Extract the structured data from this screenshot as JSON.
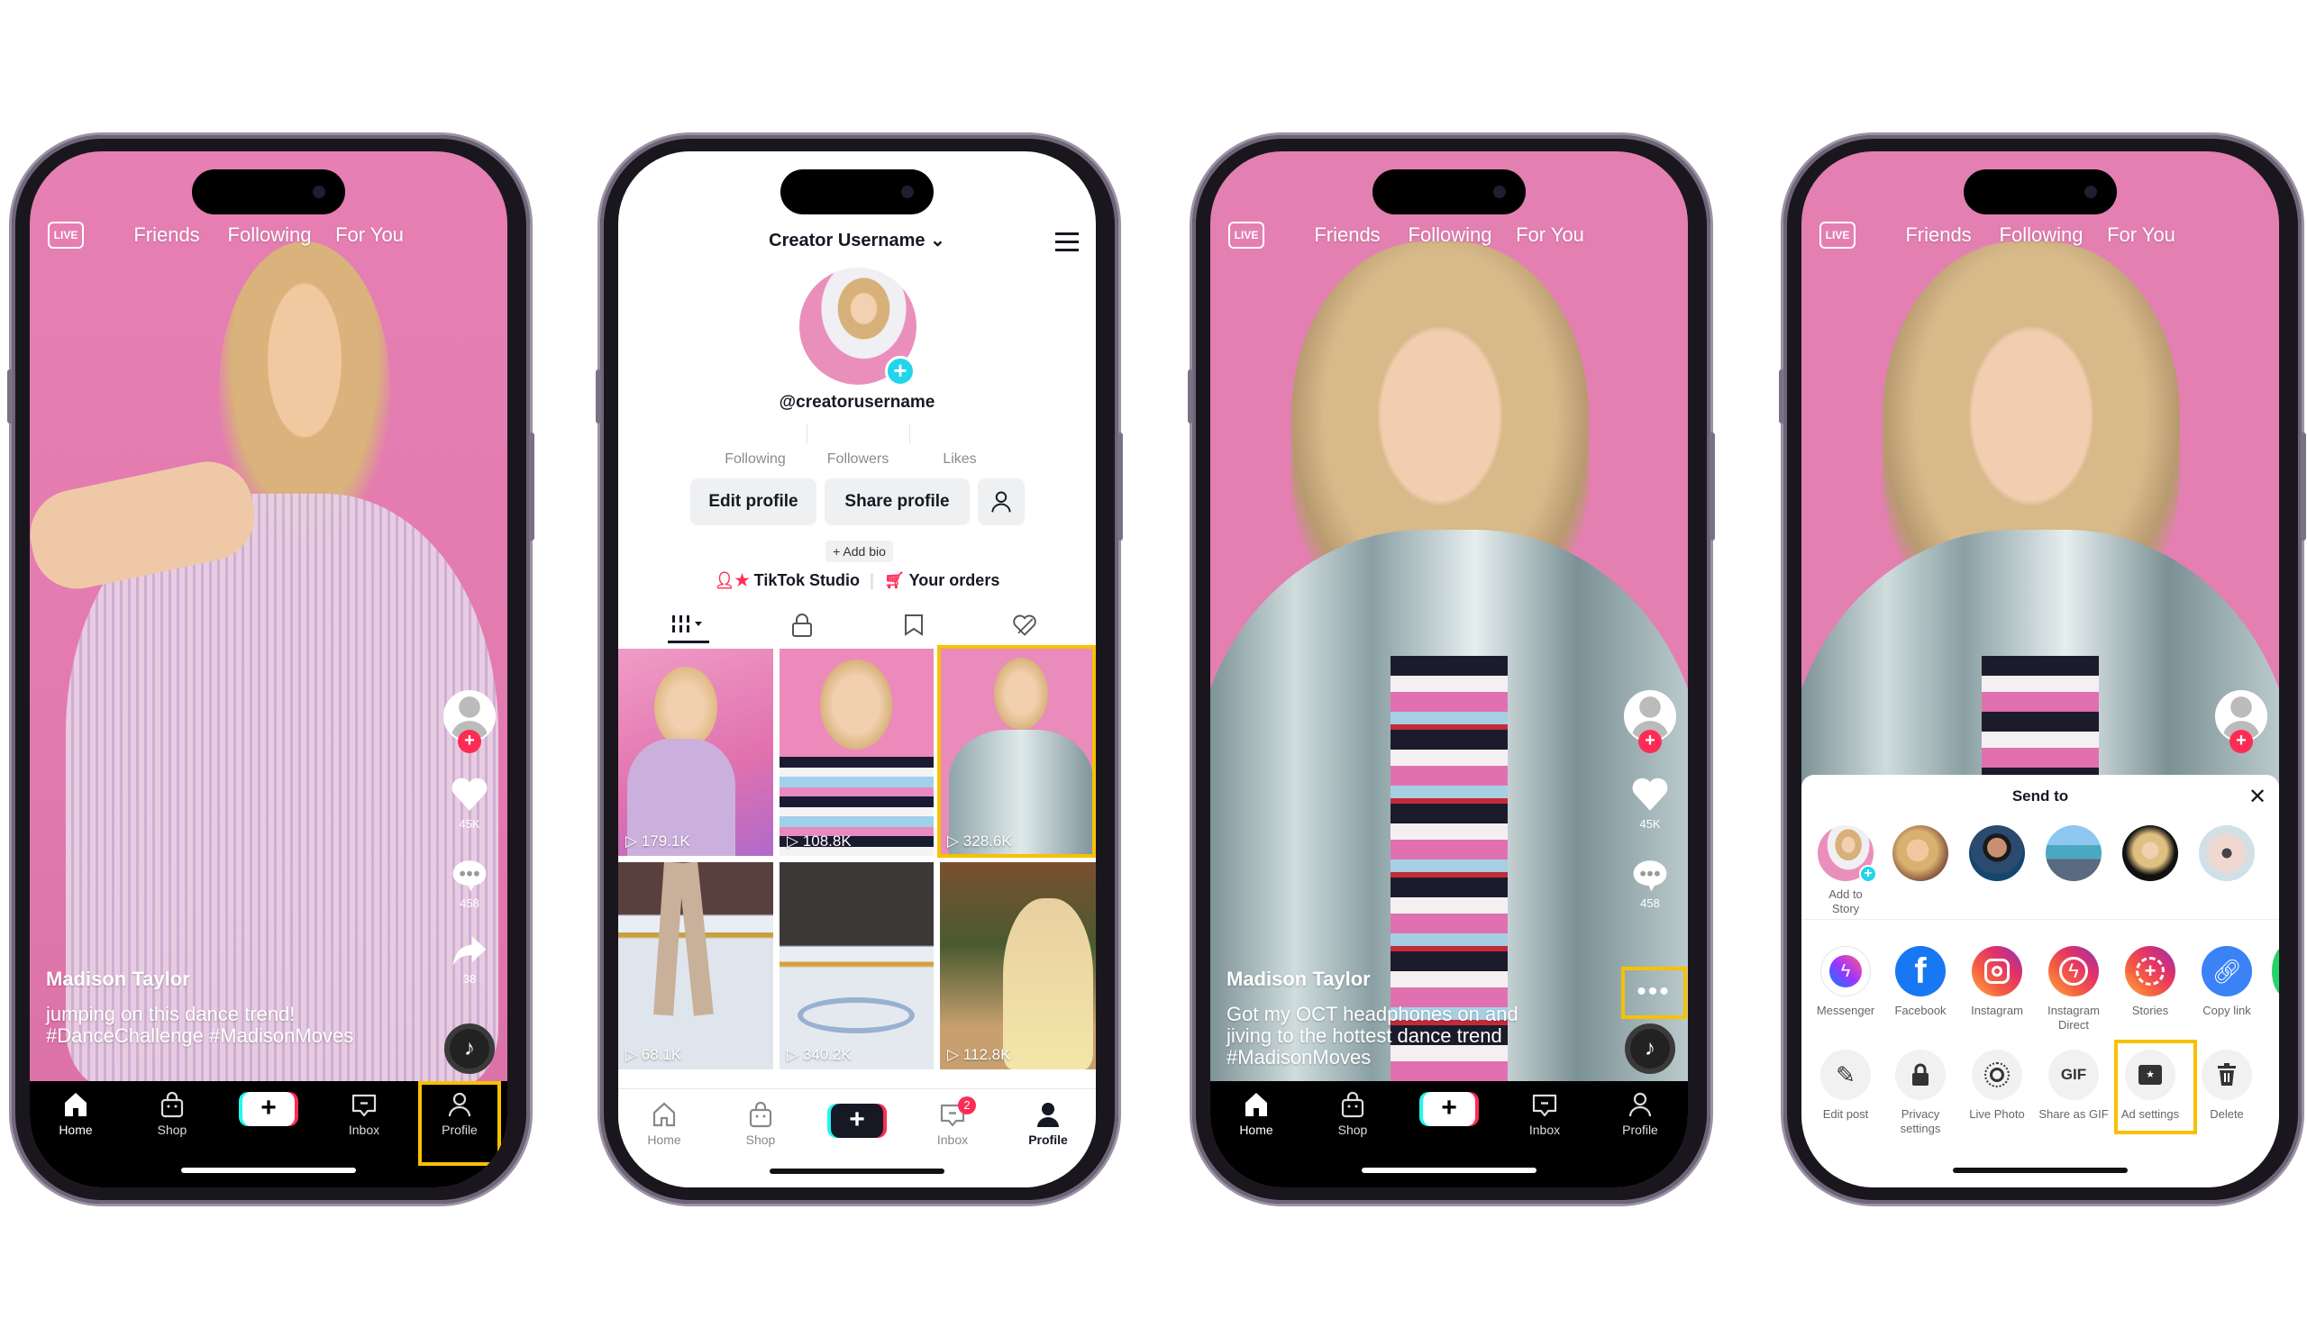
{
  "colors": {
    "highlight": "#f7c100",
    "tiktok_red": "#fe2c55",
    "tiktok_cyan": "#25f4ee",
    "feed_bg": "#e680b3"
  },
  "bottom_nav": {
    "home": "Home",
    "shop": "Shop",
    "create": "+",
    "inbox": "Inbox",
    "profile": "Profile"
  },
  "feed_top": {
    "live": "LIVE",
    "friends": "Friends",
    "following": "Following",
    "for_you": "For You"
  },
  "feed1": {
    "likes": "45K",
    "comments": "458",
    "shares": "38",
    "author": "Madison Taylor",
    "caption": [
      "jumping on this dance trend!",
      "#DanceChallenge #MadisonMoves"
    ],
    "highlighted": "Profile"
  },
  "profile": {
    "title": "Creator Username",
    "handle": "@creatorusername",
    "stats": {
      "following": "Following",
      "followers": "Followers",
      "likes": "Likes"
    },
    "edit_profile": "Edit profile",
    "share_profile": "Share profile",
    "add_bio": "+ Add bio",
    "studio": "TikTok Studio",
    "orders": "Your orders",
    "inbox_badge": "2",
    "views": [
      "179.1K",
      "108.8K",
      "328.6K",
      "68.1K",
      "340.2K",
      "112.8K"
    ],
    "highlighted_video": 3
  },
  "feed2": {
    "likes": "45K",
    "comments": "458",
    "author": "Madison Taylor",
    "caption": [
      "Got my OCT headphones on and",
      "jiving to the hottest dance trend",
      "#MadisonMoves"
    ],
    "highlighted": "more-options"
  },
  "share": {
    "title": "Send to",
    "add_to_story": [
      "Add to",
      "Story"
    ],
    "apps": [
      {
        "label": [
          "Messenger"
        ],
        "icon": "messenger-icon"
      },
      {
        "label": [
          "Facebook"
        ],
        "icon": "facebook-icon"
      },
      {
        "label": [
          "Instagram"
        ],
        "icon": "instagram-icon"
      },
      {
        "label": [
          "Instagram",
          "Direct"
        ],
        "icon": "instagram-direct-icon"
      },
      {
        "label": [
          "Stories"
        ],
        "icon": "stories-icon"
      },
      {
        "label": [
          "Copy link"
        ],
        "icon": "link-icon"
      }
    ],
    "actions": [
      {
        "label": [
          "Edit post"
        ],
        "icon": "pencil-icon"
      },
      {
        "label": [
          "Privacy",
          "settings"
        ],
        "icon": "lock-icon"
      },
      {
        "label": [
          "Live Photo"
        ],
        "icon": "live-photo-icon"
      },
      {
        "label": [
          "Share as GIF"
        ],
        "icon": "gif-icon"
      },
      {
        "label": [
          "Ad settings"
        ],
        "icon": "ad-settings-icon"
      },
      {
        "label": [
          "Delete"
        ],
        "icon": "trash-icon"
      }
    ],
    "gif_text": "GIF",
    "highlighted": "Ad settings"
  }
}
